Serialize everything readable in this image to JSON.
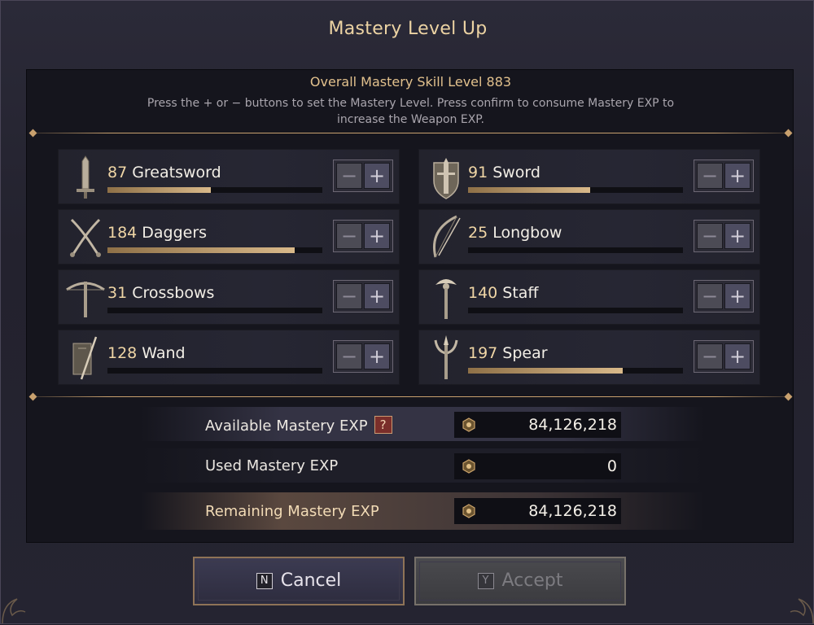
{
  "dialog": {
    "title": "Mastery Level Up",
    "overall": "Overall Mastery Skill Level 883",
    "instructions": "Press the + or − buttons to set the Mastery Level. Press confirm to consume Mastery EXP to increase the Weapon EXP."
  },
  "weapons": [
    {
      "level": "87",
      "name": "Greatsword",
      "progress": 0.48,
      "icon": "greatsword-icon"
    },
    {
      "level": "91",
      "name": "Sword",
      "progress": 0.57,
      "icon": "sword-shield-icon"
    },
    {
      "level": "184",
      "name": "Daggers",
      "progress": 0.87,
      "icon": "daggers-icon"
    },
    {
      "level": "25",
      "name": "Longbow",
      "progress": 0.0,
      "icon": "longbow-icon"
    },
    {
      "level": "31",
      "name": "Crossbows",
      "progress": 0.0,
      "icon": "crossbow-icon"
    },
    {
      "level": "140",
      "name": "Staff",
      "progress": 0.0,
      "icon": "staff-icon"
    },
    {
      "level": "128",
      "name": "Wand",
      "progress": 0.0,
      "icon": "wand-tome-icon"
    },
    {
      "level": "197",
      "name": "Spear",
      "progress": 0.72,
      "icon": "spear-trident-icon"
    }
  ],
  "controls": {
    "minus": "−",
    "plus": "+"
  },
  "exp": {
    "available_label": "Available Mastery EXP",
    "available_value": "84,126,218",
    "help": "?",
    "used_label": "Used Mastery EXP",
    "used_value": "0",
    "remaining_label": "Remaining Mastery EXP",
    "remaining_value": "84,126,218"
  },
  "buttons": {
    "cancel_key": "N",
    "cancel_label": "Cancel",
    "accept_key": "Y",
    "accept_label": "Accept"
  },
  "colors": {
    "accent_gold": "#e2c18d",
    "progress_fill": "#d9b98a",
    "background": "#1d1c27"
  }
}
